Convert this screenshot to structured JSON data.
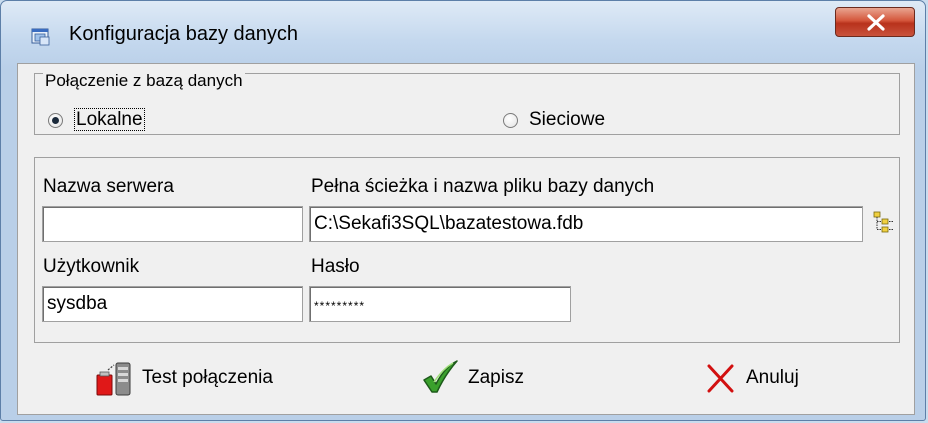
{
  "window": {
    "title": "Konfiguracja bazy danych",
    "close_label": "Close"
  },
  "connection": {
    "legend": "Połączenie z bazą danych",
    "options": [
      {
        "label": "Lokalne",
        "selected": true
      },
      {
        "label": "Sieciowe",
        "selected": false
      }
    ]
  },
  "fields": {
    "server_label": "Nazwa serwera",
    "server_value": "",
    "path_label": "Pełna ścieżka i nazwa pliku bazy danych",
    "path_value": "C:\\Sekafi3SQL\\bazatestowa.fdb",
    "user_label": "Użytkownik",
    "user_value": "sysdba",
    "password_label": "Hasło",
    "password_value": "*********"
  },
  "buttons": {
    "test_label": "Test połączenia",
    "save_label": "Zapisz",
    "cancel_label": "Anuluj"
  },
  "icons": {
    "app": "database-window-icon",
    "browse": "folder-tree-icon",
    "test": "connection-test-icon",
    "save": "checkmark-icon",
    "cancel": "x-icon"
  },
  "colors": {
    "titlebar": "#c4d8ee",
    "close_button": "#c9533c",
    "dialog_bg": "#f0f0f0",
    "save_check": "#3aa02c",
    "cancel_x": "#d21010"
  }
}
